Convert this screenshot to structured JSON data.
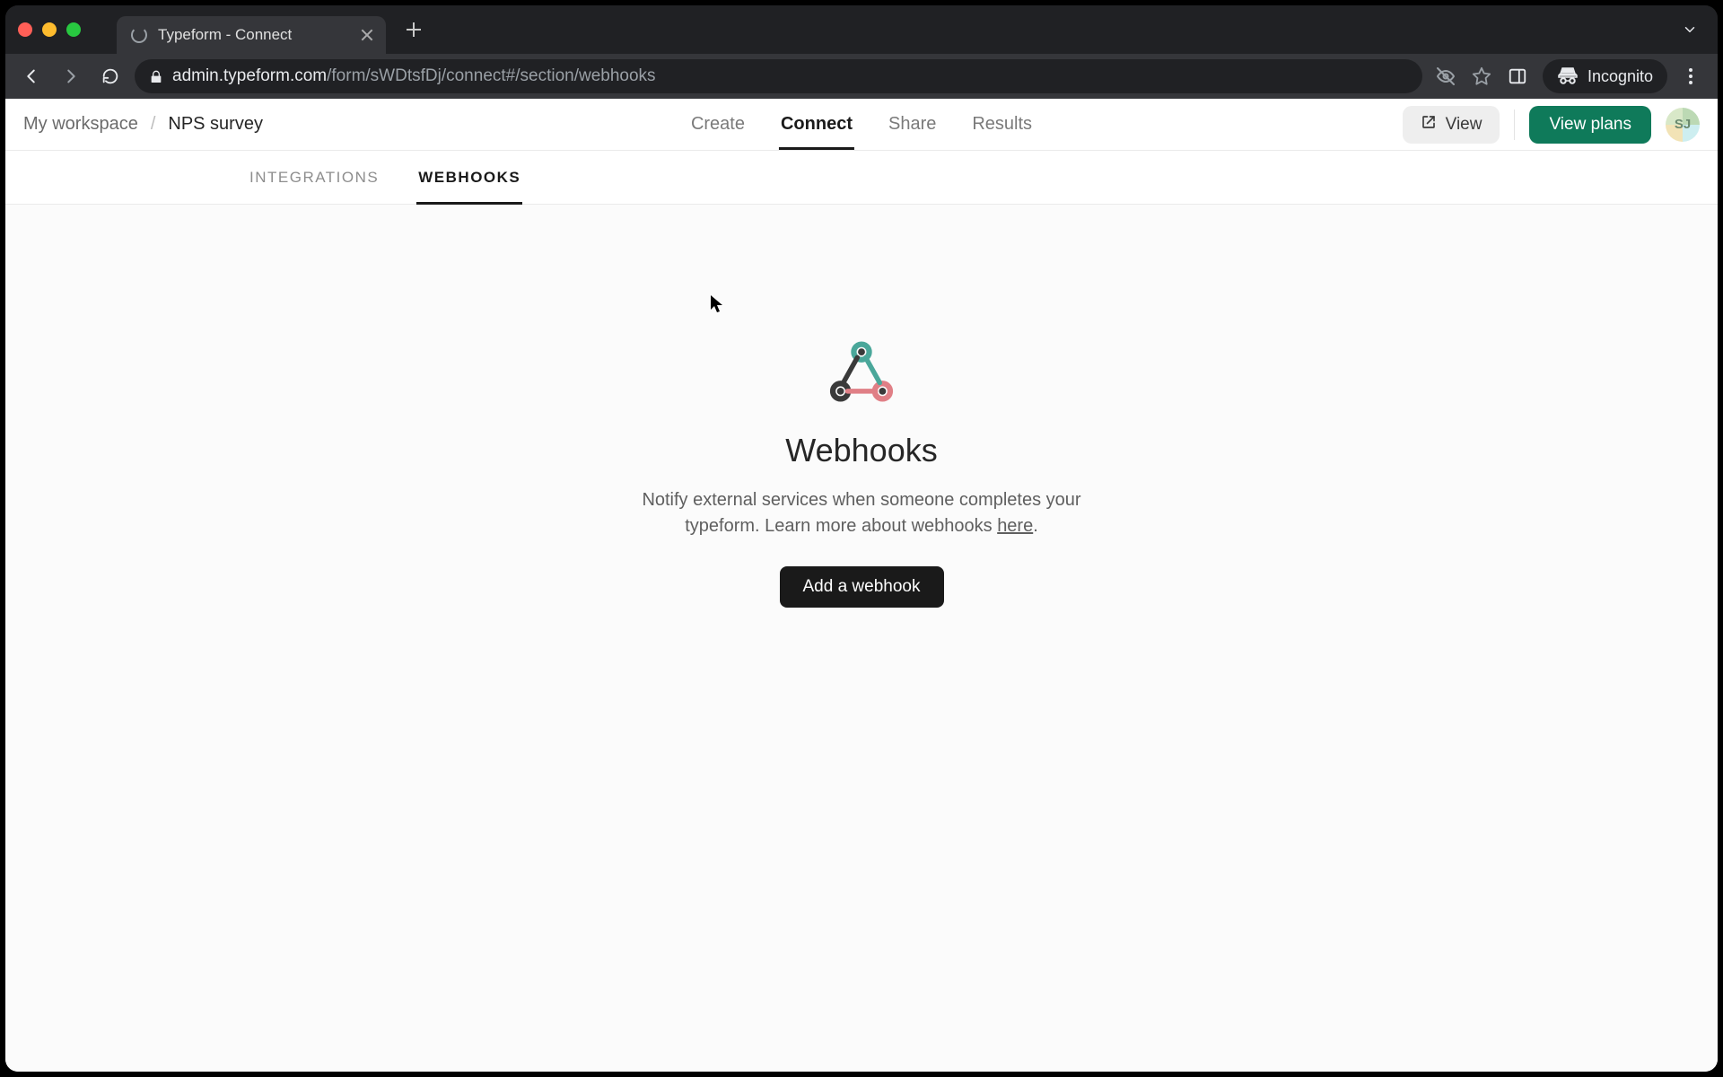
{
  "browser": {
    "tab_title": "Typeform - Connect",
    "url_host": "admin.typeform.com",
    "url_path": "/form/sWDtsfDj/connect#/section/webhooks",
    "incognito_label": "Incognito"
  },
  "header": {
    "workspace": "My workspace",
    "separator": "/",
    "form_name": "NPS survey",
    "tabs": {
      "create": "Create",
      "connect": "Connect",
      "share": "Share",
      "results": "Results",
      "active": "connect"
    },
    "view_label": "View",
    "view_plans_label": "View plans",
    "avatar_initials": "SJ"
  },
  "sub_tabs": {
    "integrations": "INTEGRATIONS",
    "webhooks": "WEBHOOKS",
    "active": "webhooks"
  },
  "panel": {
    "title": "Webhooks",
    "description_pre": "Notify external services when someone completes your typeform. Learn more about webhooks ",
    "description_link": "here",
    "description_post": ".",
    "add_button": "Add a webhook"
  },
  "colors": {
    "accent_green": "#0f7a5a",
    "text_dark": "#1a1a1a"
  }
}
